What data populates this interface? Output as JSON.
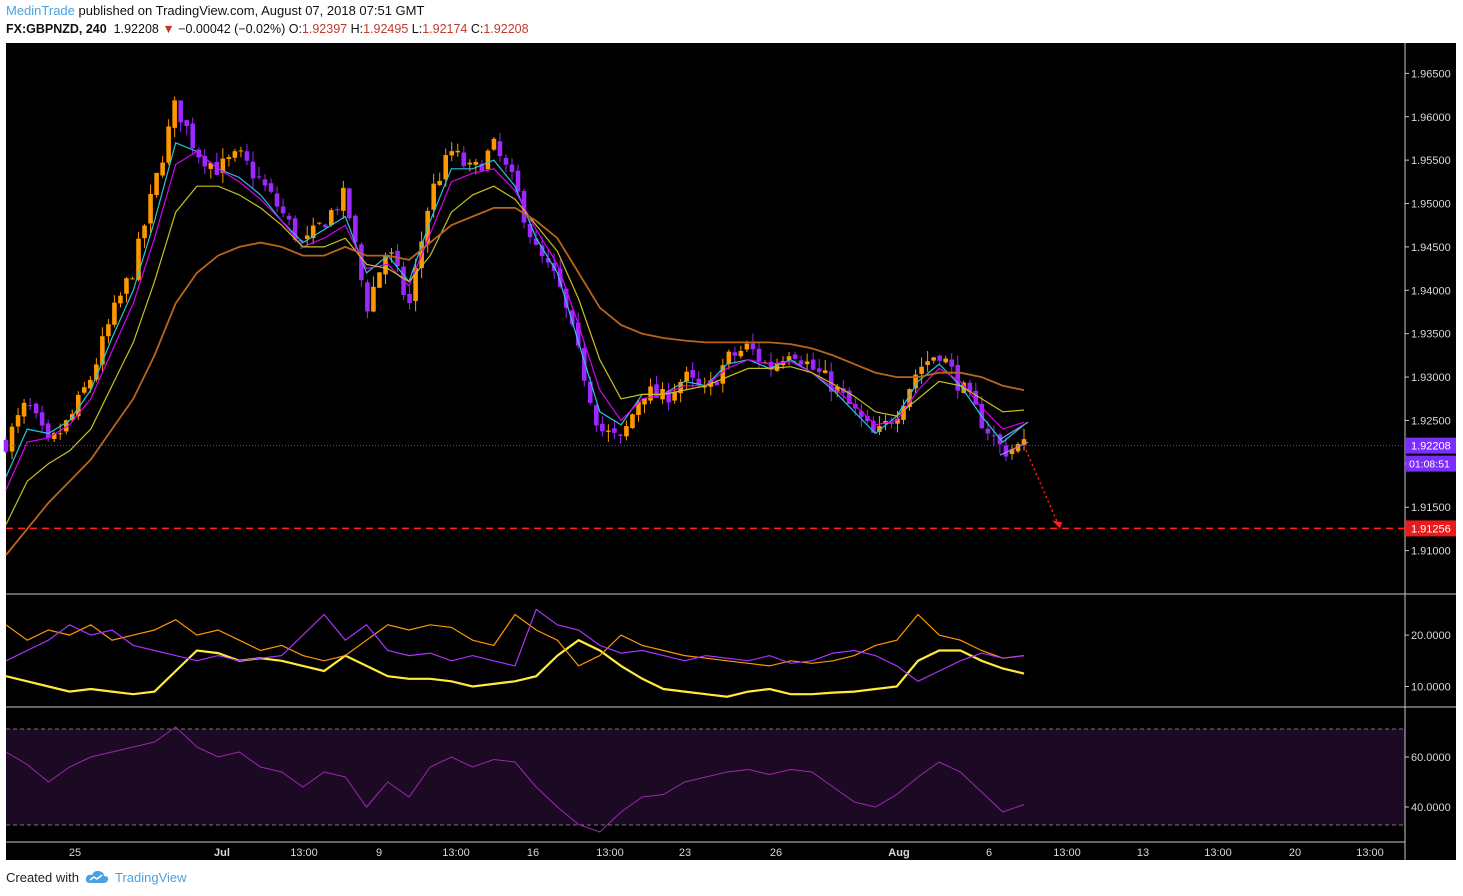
{
  "header": {
    "author": "MedinTrade",
    "published_text": " published on TradingView.com, August 07, 2018 07:51 GMT",
    "symbol": "FX:GBPNZD, 240",
    "last": "1.92208",
    "change": "−0.00042 (−0.02%)",
    "o_label": "O:",
    "o_val": "1.92397",
    "h_label": "H:",
    "h_val": "1.92495",
    "l_label": "L:",
    "l_val": "1.92174",
    "c_label": "C:",
    "c_val": "1.92208"
  },
  "footer": {
    "created_with": "Created with",
    "brand": "TradingView"
  },
  "colors": {
    "background": "#000000",
    "candle_up": "#ff9800",
    "candle_down": "#9c27ff",
    "ma_fast": "#26c6da",
    "ma_mid": "#d500f9",
    "ma_slow": "#c8c020",
    "ma_long": "#b8651a",
    "target_line": "#ff2020",
    "dmi_adx": "#ffeb3b",
    "dmi_plus": "#ff9800",
    "dmi_minus": "#aa33ff",
    "rsi": "#9c27b0"
  },
  "chart_data": [
    {
      "type": "candlestick",
      "pane": "price",
      "symbol": "FX:GBPNZD",
      "timeframe": "240",
      "ylim": [
        1.905,
        1.9685
      ],
      "y_ticks": [
        "1.96500",
        "1.96000",
        "1.95500",
        "1.95000",
        "1.94500",
        "1.94000",
        "1.93500",
        "1.93000",
        "1.92500",
        "1.92000",
        "1.91500",
        "1.91000"
      ],
      "x_ticks": [
        "25",
        "Jul",
        "13:00",
        "9",
        "13:00",
        "16",
        "13:00",
        "23",
        "26",
        "Aug",
        "6",
        "13:00",
        "13",
        "13:00",
        "20",
        "13:00"
      ],
      "close_path": [
        1.9225,
        1.927,
        1.922,
        1.925,
        1.93,
        1.937,
        1.9425,
        1.952,
        1.9615,
        1.956,
        1.954,
        1.9555,
        1.9525,
        1.949,
        1.945,
        1.948,
        1.951,
        1.938,
        1.945,
        1.938,
        1.951,
        1.956,
        1.9535,
        1.9565,
        1.952,
        1.9445,
        1.941,
        1.9325,
        1.924,
        1.9225,
        1.9285,
        1.9275,
        1.93,
        1.928,
        1.932,
        1.9335,
        1.931,
        1.9335,
        1.931,
        1.929,
        1.926,
        1.923,
        1.926,
        1.931,
        1.933,
        1.929,
        1.925,
        1.9215,
        1.9221
      ],
      "moving_averages": [
        {
          "values": [
            1.9185,
            1.924,
            1.9235,
            1.925,
            1.9285,
            1.9345,
            1.94,
            1.948,
            1.957,
            1.956,
            1.954,
            1.953,
            1.951,
            1.948,
            1.9455,
            1.947,
            1.9485,
            1.942,
            1.944,
            1.941,
            1.948,
            1.954,
            1.954,
            1.955,
            1.952,
            1.946,
            1.942,
            1.934,
            1.926,
            1.9245,
            1.928,
            1.928,
            1.9295,
            1.929,
            1.9315,
            1.932,
            1.931,
            1.932,
            1.9305,
            1.9285,
            1.926,
            1.9235,
            1.9255,
            1.9295,
            1.9315,
            1.929,
            1.9255,
            1.9225,
            1.9245
          ]
        },
        {
          "values": [
            1.917,
            1.9225,
            1.923,
            1.9245,
            1.9275,
            1.933,
            1.9385,
            1.946,
            1.9545,
            1.956,
            1.954,
            1.9525,
            1.9505,
            1.948,
            1.945,
            1.946,
            1.9475,
            1.9425,
            1.943,
            1.9405,
            1.9465,
            1.9525,
            1.9535,
            1.954,
            1.9515,
            1.947,
            1.943,
            1.936,
            1.9285,
            1.925,
            1.9275,
            1.928,
            1.929,
            1.929,
            1.931,
            1.932,
            1.9315,
            1.9318,
            1.9305,
            1.9288,
            1.9268,
            1.9245,
            1.925,
            1.9285,
            1.931,
            1.9295,
            1.9265,
            1.924,
            1.9248
          ]
        },
        {
          "values": [
            1.913,
            1.918,
            1.92,
            1.9215,
            1.924,
            1.929,
            1.934,
            1.941,
            1.949,
            1.952,
            1.952,
            1.951,
            1.9495,
            1.9475,
            1.945,
            1.945,
            1.946,
            1.943,
            1.9425,
            1.941,
            1.944,
            1.949,
            1.951,
            1.952,
            1.9505,
            1.9475,
            1.9445,
            1.939,
            1.932,
            1.9275,
            1.928,
            1.928,
            1.9285,
            1.929,
            1.93,
            1.931,
            1.931,
            1.9312,
            1.9305,
            1.9292,
            1.9278,
            1.926,
            1.9255,
            1.9275,
            1.9295,
            1.929,
            1.9275,
            1.926,
            1.9262
          ]
        },
        {
          "values": [
            1.9095,
            1.9125,
            1.9155,
            1.918,
            1.9205,
            1.924,
            1.9275,
            1.9325,
            1.9385,
            1.942,
            1.944,
            1.945,
            1.9455,
            1.945,
            1.944,
            1.944,
            1.945,
            1.944,
            1.944,
            1.9435,
            1.9455,
            1.9475,
            1.9485,
            1.9495,
            1.9495,
            1.948,
            1.946,
            1.942,
            1.938,
            1.936,
            1.935,
            1.9345,
            1.9342,
            1.934,
            1.934,
            1.934,
            1.934,
            1.9338,
            1.9333,
            1.9325,
            1.9315,
            1.9305,
            1.93,
            1.93,
            1.9305,
            1.9305,
            1.93,
            1.929,
            1.9285
          ]
        }
      ],
      "last_price_label": "1.92208",
      "countdown_label": "01:08:51",
      "target_level": 1.91256,
      "target_label": "1.91256",
      "projection": {
        "from": 1.9221,
        "to": 1.91256
      }
    },
    {
      "type": "line",
      "pane": "dmi",
      "ylim": [
        6.0,
        28.0
      ],
      "y_ticks": [
        "20.0000",
        "10.0000"
      ],
      "series": [
        {
          "values": [
            12.0,
            11.0,
            10.0,
            9.0,
            9.5,
            9.0,
            8.5,
            9.0,
            13.0,
            17.0,
            16.5,
            15.0,
            15.5,
            15.0,
            14.0,
            13.0,
            16.0,
            14.0,
            12.0,
            11.5,
            11.5,
            11.0,
            10.0,
            10.5,
            11.0,
            12.0,
            16.0,
            19.0,
            17.0,
            14.0,
            11.5,
            9.5,
            9.0,
            8.5,
            8.0,
            9.0,
            9.5,
            8.5,
            8.5,
            8.8,
            9.0,
            9.5,
            10.0,
            15.0,
            17.0,
            17.0,
            15.0,
            13.5,
            12.5
          ]
        },
        {
          "values": [
            22.0,
            19.0,
            21.0,
            20.0,
            22.0,
            19.0,
            20.0,
            21.0,
            23.0,
            20.0,
            21.0,
            19.0,
            17.0,
            18.0,
            16.0,
            15.0,
            16.0,
            19.0,
            22.0,
            21.0,
            22.0,
            21.5,
            19.0,
            18.0,
            24.0,
            21.0,
            19.0,
            14.0,
            16.0,
            20.0,
            18.0,
            17.0,
            16.0,
            15.5,
            15.0,
            14.5,
            14.0,
            15.0,
            14.5,
            15.0,
            16.0,
            18.0,
            19.0,
            24.0,
            20.0,
            19.0,
            17.0,
            15.5,
            16.0
          ]
        },
        {
          "values": [
            15.0,
            17.0,
            19.0,
            22.0,
            20.0,
            21.0,
            18.0,
            17.0,
            16.0,
            15.0,
            16.0,
            15.0,
            15.5,
            16.0,
            20.0,
            24.0,
            19.0,
            22.0,
            17.0,
            16.0,
            16.5,
            15.0,
            16.0,
            15.0,
            14.0,
            25.0,
            22.0,
            21.0,
            18.0,
            16.5,
            17.0,
            16.0,
            15.0,
            16.0,
            15.5,
            15.0,
            16.0,
            14.5,
            15.0,
            16.5,
            17.0,
            16.0,
            14.0,
            11.0,
            13.0,
            15.0,
            16.5,
            15.5,
            16.0
          ]
        }
      ]
    },
    {
      "type": "line",
      "pane": "rsi",
      "ylim": [
        26.0,
        80.0
      ],
      "y_ticks": [
        "60.0000",
        "40.0000"
      ],
      "bands": [
        70,
        30
      ],
      "series": [
        {
          "values": [
            62.0,
            57.0,
            50.0,
            56.0,
            60.0,
            62.0,
            64.0,
            66.0,
            72.0,
            64.0,
            60.0,
            62.0,
            56.0,
            54.0,
            48.0,
            54.0,
            52.0,
            40.0,
            50.0,
            44.0,
            56.0,
            60.0,
            56.0,
            59.0,
            58.0,
            48.0,
            40.0,
            33.0,
            30.0,
            38.0,
            44.0,
            45.0,
            50.0,
            52.0,
            54.0,
            55.0,
            53.0,
            55.0,
            54.0,
            48.0,
            42.0,
            40.0,
            45.0,
            52.0,
            58.0,
            54.0,
            46.0,
            38.0,
            41.0
          ]
        }
      ]
    }
  ]
}
